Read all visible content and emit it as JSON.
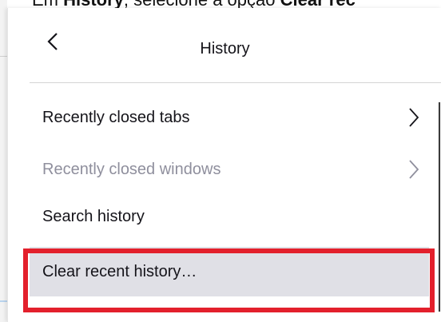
{
  "caption": {
    "prefix": "Em ",
    "bold_word": "History",
    "middle": ", selecione a opção ",
    "bold_tail": "Clear rec"
  },
  "panel": {
    "back_icon": "chevron-left-icon",
    "title": "History"
  },
  "menu": {
    "items": [
      {
        "label": "Recently closed tabs",
        "has_submenu": true,
        "enabled": true,
        "icon": "chevron-right-icon"
      },
      {
        "label": "Recently closed windows",
        "has_submenu": true,
        "enabled": false,
        "icon": "chevron-right-icon"
      },
      {
        "label": "Search history",
        "has_submenu": false,
        "enabled": true
      },
      {
        "label": "Clear recent history…",
        "has_submenu": false,
        "enabled": true,
        "highlighted": true
      }
    ]
  },
  "colors": {
    "highlight_border": "#e3202c",
    "hover_bg": "#e0e0e6",
    "text": "#15141a",
    "disabled_text": "#8f8f9d"
  }
}
